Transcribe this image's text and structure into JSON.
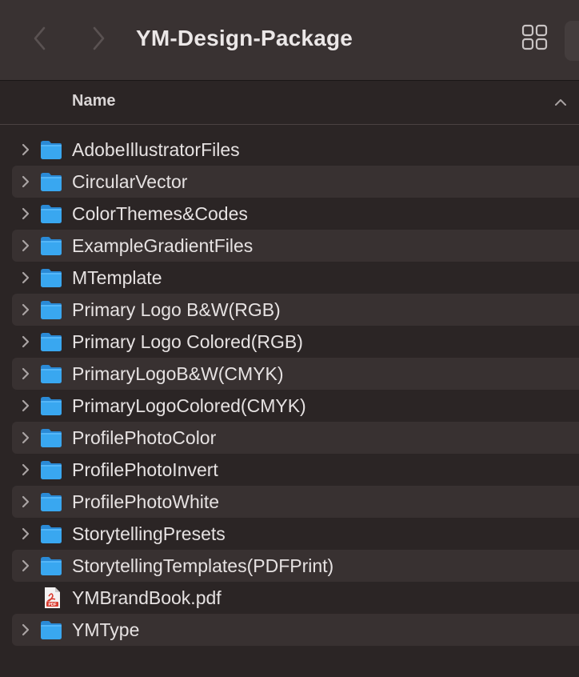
{
  "window": {
    "title": "YM-Design-Package"
  },
  "toolbar": {
    "back_icon": "chevron-left-icon",
    "forward_icon": "chevron-right-icon",
    "view_icon": "grid-view-icon"
  },
  "header": {
    "name_column": "Name",
    "sort_icon": "chevron-up-icon"
  },
  "colors": {
    "folder_blue": "#39a7f0",
    "background": "#2b2525",
    "toolbar": "#393232",
    "row_alt": "#383131"
  },
  "files": [
    {
      "name": "AdobeIllustratorFiles",
      "type": "folder"
    },
    {
      "name": "CircularVector",
      "type": "folder"
    },
    {
      "name": "ColorThemes&Codes",
      "type": "folder"
    },
    {
      "name": "ExampleGradientFiles",
      "type": "folder"
    },
    {
      "name": "MTemplate",
      "type": "folder"
    },
    {
      "name": "Primary Logo B&W(RGB)",
      "type": "folder"
    },
    {
      "name": "Primary Logo Colored(RGB)",
      "type": "folder"
    },
    {
      "name": "PrimaryLogoB&W(CMYK)",
      "type": "folder"
    },
    {
      "name": "PrimaryLogoColored(CMYK)",
      "type": "folder"
    },
    {
      "name": "ProfilePhotoColor",
      "type": "folder"
    },
    {
      "name": "ProfilePhotoInvert",
      "type": "folder"
    },
    {
      "name": "ProfilePhotoWhite",
      "type": "folder"
    },
    {
      "name": "StorytellingPresets",
      "type": "folder"
    },
    {
      "name": "StorytellingTemplates(PDFPrint)",
      "type": "folder"
    },
    {
      "name": "YMBrandBook.pdf",
      "type": "pdf",
      "icon_label": "PDF"
    },
    {
      "name": "YMType",
      "type": "folder"
    }
  ]
}
